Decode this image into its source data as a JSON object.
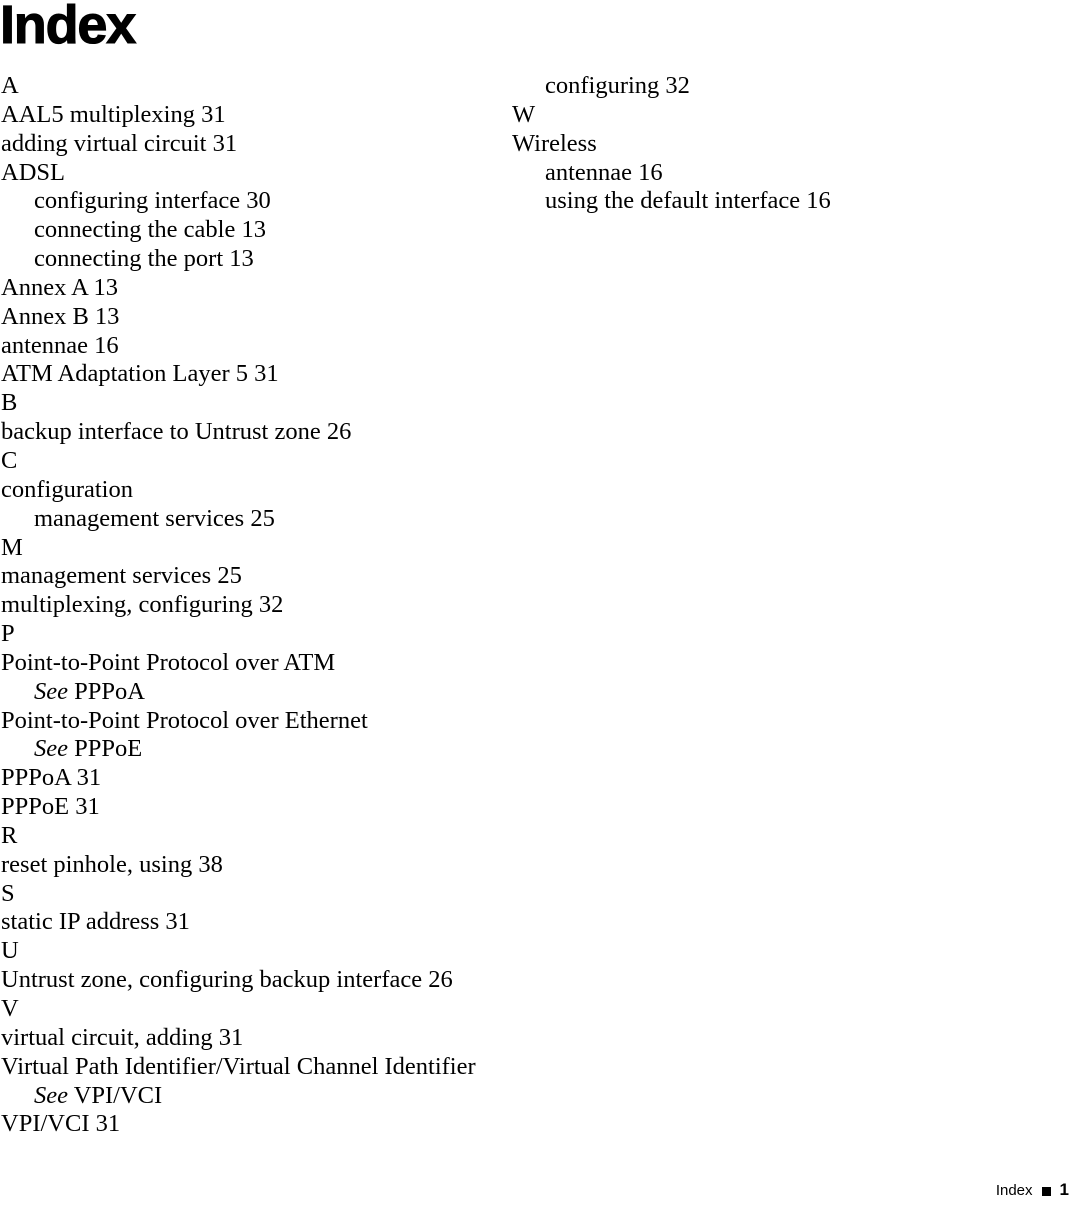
{
  "document": {
    "title": "Index"
  },
  "footer": {
    "label": "Index",
    "separator_icon": "square-bullet",
    "page_number": "1"
  },
  "index": {
    "columns": [
      {
        "name": "left",
        "lines": [
          {
            "type": "letter",
            "text": "A"
          },
          {
            "type": "entry",
            "text": "AAL5 multiplexing 31"
          },
          {
            "type": "entry",
            "text": "adding virtual circuit 31"
          },
          {
            "type": "entry",
            "text": "ADSL"
          },
          {
            "type": "sub",
            "text": "configuring interface 30"
          },
          {
            "type": "sub",
            "text": "connecting the cable 13"
          },
          {
            "type": "sub",
            "text": "connecting the port 13"
          },
          {
            "type": "entry",
            "text": "Annex A 13"
          },
          {
            "type": "entry",
            "text": "Annex B 13"
          },
          {
            "type": "entry",
            "text": "antennae 16"
          },
          {
            "type": "entry",
            "text": "ATM Adaptation Layer 5 31"
          },
          {
            "type": "letter",
            "text": "B"
          },
          {
            "type": "entry",
            "text": "backup interface to Untrust zone 26"
          },
          {
            "type": "letter",
            "text": "C"
          },
          {
            "type": "entry",
            "text": "configuration"
          },
          {
            "type": "sub",
            "text": "management services 25"
          },
          {
            "type": "letter",
            "text": "M"
          },
          {
            "type": "entry",
            "text": "management services 25"
          },
          {
            "type": "entry",
            "text": "multiplexing, configuring 32"
          },
          {
            "type": "letter",
            "text": "P"
          },
          {
            "type": "entry",
            "text": "Point-to-Point Protocol over ATM"
          },
          {
            "type": "see",
            "see": "See",
            "text": "PPPoA"
          },
          {
            "type": "entry",
            "text": "Point-to-Point Protocol over Ethernet"
          },
          {
            "type": "see",
            "see": "See",
            "text": "PPPoE"
          },
          {
            "type": "entry",
            "text": "PPPoA 31"
          },
          {
            "type": "entry",
            "text": "PPPoE 31"
          },
          {
            "type": "letter",
            "text": "R"
          },
          {
            "type": "entry",
            "text": "reset pinhole, using 38"
          },
          {
            "type": "letter",
            "text": "S"
          },
          {
            "type": "entry",
            "text": "static IP address 31"
          },
          {
            "type": "letter",
            "text": "U"
          },
          {
            "type": "entry",
            "text": "Untrust zone, configuring backup interface 26"
          },
          {
            "type": "letter",
            "text": "V"
          },
          {
            "type": "entry",
            "text": "virtual circuit, adding 31"
          },
          {
            "type": "entry",
            "text": "Virtual Path Identifier/Virtual Channel Identifier"
          },
          {
            "type": "see",
            "see": "See",
            "text": "VPI/VCI"
          },
          {
            "type": "entry",
            "text": "VPI/VCI 31"
          }
        ]
      },
      {
        "name": "right",
        "lines": [
          {
            "type": "sub",
            "text": "configuring 32"
          },
          {
            "type": "letter",
            "text": "W"
          },
          {
            "type": "entry",
            "text": "Wireless"
          },
          {
            "type": "sub",
            "text": "antennae 16"
          },
          {
            "type": "sub",
            "text": "using the default interface 16"
          }
        ]
      }
    ]
  }
}
